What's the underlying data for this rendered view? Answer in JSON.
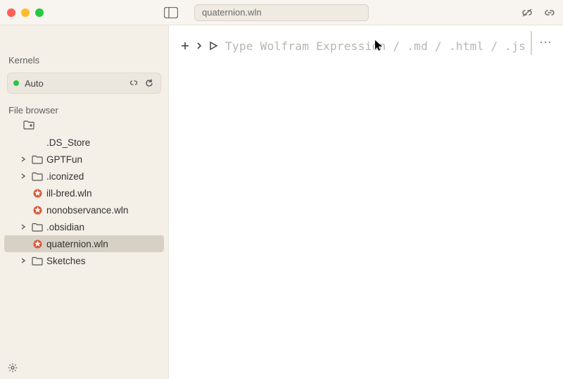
{
  "titlebar": {
    "filename": "quaternion.wln"
  },
  "sidebar": {
    "kernels_title": "Kernels",
    "kernel_label": "Auto",
    "filebrowser_title": "File browser",
    "tree": [
      {
        "name": ".DS_Store",
        "type": "file-generic",
        "expandable": false
      },
      {
        "name": "GPTFun",
        "type": "folder",
        "expandable": true
      },
      {
        "name": ".iconized",
        "type": "folder",
        "expandable": true
      },
      {
        "name": "ill-bred.wln",
        "type": "wln",
        "expandable": false
      },
      {
        "name": "nonobservance.wln",
        "type": "wln",
        "expandable": false
      },
      {
        "name": ".obsidian",
        "type": "folder",
        "expandable": true
      },
      {
        "name": "quaternion.wln",
        "type": "wln",
        "expandable": false,
        "selected": true
      },
      {
        "name": "Sketches",
        "type": "folder",
        "expandable": true
      }
    ]
  },
  "editor": {
    "placeholder": "Type Wolfram Expression / .md / .html / .js"
  }
}
